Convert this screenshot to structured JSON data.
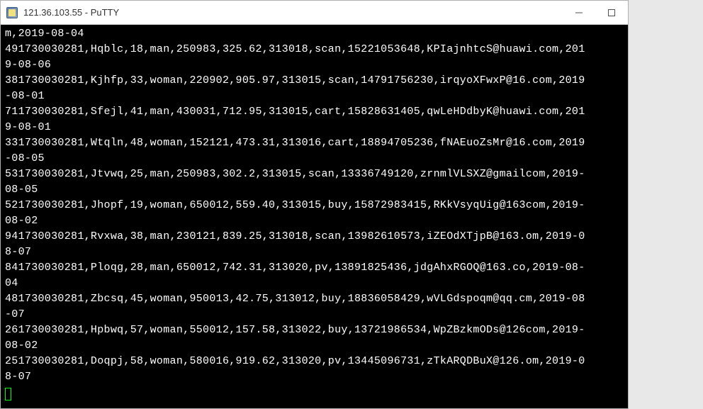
{
  "window": {
    "title": "121.36.103.55 - PuTTY"
  },
  "terminal": {
    "lines": [
      "m,2019-08-04",
      "491730030281,Hqblc,18,man,250983,325.62,313018,scan,15221053648,KPIajnhtcS@huawi.com,2019-08-06",
      "381730030281,Kjhfp,33,woman,220902,905.97,313015,scan,14791756230,irqyoXFwxP@16.com,2019-08-01",
      "711730030281,Sfejl,41,man,430031,712.95,313015,cart,15828631405,qwLeHDdbyK@huawi.com,2019-08-01",
      "331730030281,Wtqln,48,woman,152121,473.31,313016,cart,18894705236,fNAEuoZsMr@16.com,2019-08-05",
      "531730030281,Jtvwq,25,man,250983,302.2,313015,scan,13336749120,zrnmlVLSXZ@gmailcom,2019-08-05",
      "521730030281,Jhopf,19,woman,650012,559.40,313015,buy,15872983415,RKkVsyqUig@163com,2019-08-02",
      "941730030281,Rvxwa,38,man,230121,839.25,313018,scan,13982610573,iZEOdXTjpB@163.om,2019-08-07",
      "841730030281,Ploqg,28,man,650012,742.31,313020,pv,13891825436,jdgAhxRGOQ@163.co,2019-08-04",
      "481730030281,Zbcsq,45,woman,950013,42.75,313012,buy,18836058429,wVLGdspoqm@qq.cm,2019-08-07",
      "261730030281,Hpbwq,57,woman,550012,157.58,313022,buy,13721986534,WpZBzkmODs@126com,2019-08-02",
      "251730030281,Doqpj,58,woman,580016,919.62,313020,pv,13445096731,zTkARQDBuX@126.om,2019-08-07"
    ],
    "wrap_width": 88
  }
}
